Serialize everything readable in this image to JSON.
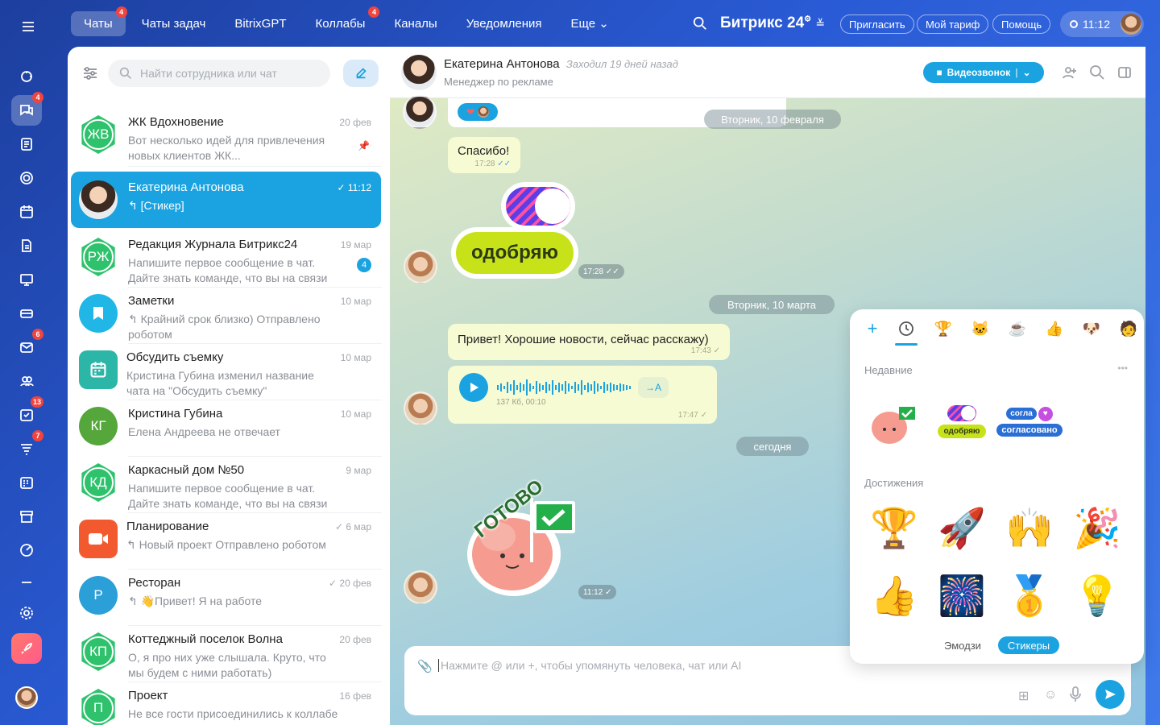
{
  "topnav": {
    "tabs": [
      {
        "label": "Чаты",
        "badge": "4",
        "active": true
      },
      {
        "label": "Чаты задач",
        "badge": ""
      },
      {
        "label": "BitrixGPT",
        "badge": ""
      },
      {
        "label": "Коллабы",
        "badge": "4"
      },
      {
        "label": "Каналы",
        "badge": ""
      },
      {
        "label": "Уведомления",
        "badge": ""
      },
      {
        "label": "Еще",
        "badge": ""
      }
    ],
    "logo": "Битрикс 24",
    "invite": "Пригласить",
    "plan": "Мой тариф",
    "help": "Помощь",
    "time": "11:12"
  },
  "rail": {
    "badges": {
      "chats": "4",
      "mail": "6",
      "tasks": "13",
      "filter": "7"
    }
  },
  "sidebar": {
    "search_placeholder": "Найти сотрудника или чат"
  },
  "chats": [
    {
      "initials": "ЖВ",
      "title": "ЖК Вдохновение",
      "date": "20 фев",
      "preview": "Вот несколько идей для привлечения новых клиентов ЖК..."
    },
    {
      "initials": "",
      "title": "Екатерина Антонова",
      "date": "11:12",
      "preview": "↰ [Стикер]"
    },
    {
      "initials": "РЖ",
      "title": "Редакция Журнала Битрикс24",
      "date": "19 мар",
      "preview": "Напишите первое сообщение в чат. Дайте знать команде, что вы на связи",
      "count": "4"
    },
    {
      "initials": "",
      "title": "Заметки",
      "date": "10 мар",
      "preview": "↰ Крайний срок близко) Отправлено роботом"
    },
    {
      "initials": "",
      "title": "Обсудить съемку",
      "date": "10 мар",
      "preview": "Кристина Губина изменил название чата на \"Обсудить съемку\""
    },
    {
      "initials": "КГ",
      "title": "Кристина Губина",
      "date": "10 мар",
      "preview": "Елена Андреева не отвечает"
    },
    {
      "initials": "КД",
      "title": "Каркасный дом №50",
      "date": "9 мар",
      "preview": "Напишите первое сообщение в чат. Дайте знать команде, что вы на связи"
    },
    {
      "initials": "",
      "title": "Планирование",
      "date": "6 мар",
      "preview": "↰ Новый проект Отправлено роботом"
    },
    {
      "initials": "Р",
      "title": "Ресторан",
      "date": "20 фев",
      "preview": "↰ 👋Привет! Я на работе"
    },
    {
      "initials": "КП",
      "title": "Коттеджный поселок Волна",
      "date": "20 фев",
      "preview": "О, я про них уже слышала. Круто, что мы будем с ними работать)"
    },
    {
      "initials": "П",
      "title": "Проект",
      "date": "16 фев",
      "preview": "Не все гости присоединились к коллабе"
    }
  ],
  "header": {
    "name": "Екатерина Антонова",
    "status": "Заходил 19 дней назад",
    "role": "Менеджер по рекламе",
    "video": "Видеозвонок"
  },
  "messages": {
    "date1": "Вторник, 10 февраля",
    "thanks": "Спасибо!",
    "thanks_time": "17:28",
    "sticker1_text": "одобряю",
    "sticker1_time": "17:28",
    "date2": "Вторник, 10 марта",
    "hello": "Привет! Хорошие новости, сейчас расскажу)",
    "hello_time": "17:43",
    "voice_meta": "137 Кб, 00:10",
    "voice_time": "17:47",
    "date3": "сегодня",
    "sticker2_text": "ГОТОВО",
    "sticker2_time": "11:12"
  },
  "composer": {
    "placeholder": "Нажмите @ или +, чтобы упомянуть человека, чат или AI"
  },
  "sticker_panel": {
    "recent_label": "Недавние",
    "achievements_label": "Достижения",
    "recent_tags": [
      "одобряю",
      "согласовано"
    ],
    "emoji_tab": "Эмодзи",
    "stickers_tab": "Стикеры"
  }
}
